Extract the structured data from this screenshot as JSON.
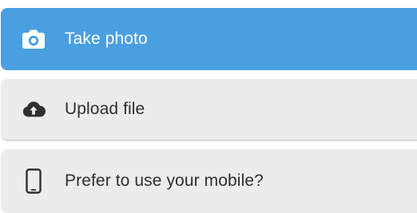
{
  "options": [
    {
      "label": "Take photo",
      "icon": "camera-icon"
    },
    {
      "label": "Upload file",
      "icon": "cloud-upload-icon"
    },
    {
      "label": "Prefer to use your mobile?",
      "icon": "mobile-phone-icon"
    }
  ],
  "colors": {
    "primary": "#4a9fe0",
    "secondary_bg": "#ececec",
    "text_dark": "#2f2f2f",
    "text_light": "#ffffff"
  }
}
